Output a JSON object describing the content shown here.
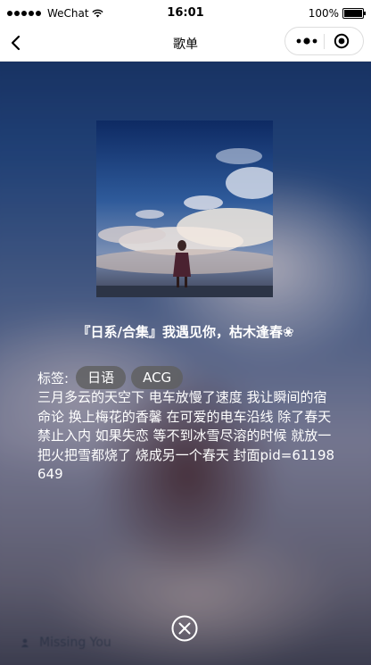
{
  "status_bar": {
    "carrier": "WeChat",
    "time": "16:01",
    "battery": "100%"
  },
  "nav": {
    "title": "歌单"
  },
  "playlist": {
    "title": "『日系/合集』我遇见你，枯木逢春❀",
    "tags_label": "标签:",
    "tags": [
      "日语",
      "ACG"
    ],
    "description": "三月多云的天空下 电车放慢了速度 我让瞬间的宿命论 换上梅花的香馨 在可爱的电车沿线 除了春天 禁止入内 如果失恋 等不到冰雪尽溶的时候 就放一把火把雪都烧了 烧成另一个春天 封面pid=61198649"
  },
  "background_peek": {
    "song_title": "Missing You"
  },
  "colors": {
    "bg_top": "#13295a",
    "text": "#ffffff",
    "tag_bg": "#5f5f5f"
  },
  "icons": [
    "signal-dots-icon",
    "wifi-icon",
    "battery-icon",
    "back-arrow-icon",
    "more-dots-icon",
    "miniprogram-close-icon",
    "close-circle-icon"
  ]
}
